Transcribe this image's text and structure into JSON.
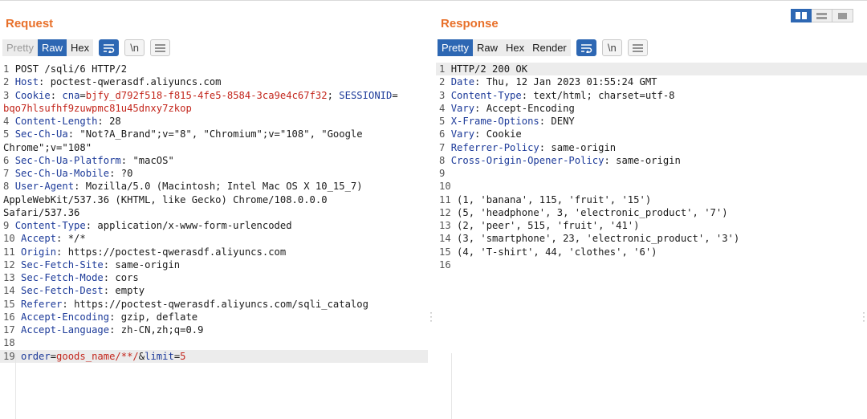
{
  "request": {
    "title": "Request",
    "tabs": [
      "Pretty",
      "Raw",
      "Hex"
    ],
    "active_tab": "Raw",
    "newline_label": "\\n",
    "lines": [
      [
        {
          "t": "1 ",
          "c": "num"
        },
        {
          "t": "POST /sqli/6 HTTP/2"
        }
      ],
      [
        {
          "t": "2 ",
          "c": "num"
        },
        {
          "t": "Host",
          "c": "key"
        },
        {
          "t": ": poctest-qwerasdf.aliyuncs.com"
        }
      ],
      [
        {
          "t": "3 ",
          "c": "num"
        },
        {
          "t": "Cookie",
          "c": "key"
        },
        {
          "t": ": "
        },
        {
          "t": "cna",
          "c": "key"
        },
        {
          "t": "="
        },
        {
          "t": "bjfy_d792f518-f815-4fe5-8584-3ca9e4c67f32",
          "c": "val"
        },
        {
          "t": "; "
        },
        {
          "t": "SESSIONID",
          "c": "key"
        },
        {
          "t": "="
        }
      ],
      [
        {
          "t": "bqo7hlsufhf9zuwpmc81u45dnxy7zkop",
          "c": "val"
        }
      ],
      [
        {
          "t": "4 ",
          "c": "num"
        },
        {
          "t": "Content-Length",
          "c": "key"
        },
        {
          "t": ": 28"
        }
      ],
      [
        {
          "t": "5 ",
          "c": "num"
        },
        {
          "t": "Sec-Ch-Ua",
          "c": "key"
        },
        {
          "t": ": \"Not?A_Brand\";v=\"8\", \"Chromium\";v=\"108\", \"Google"
        }
      ],
      [
        {
          "t": "Chrome\";v=\"108\""
        }
      ],
      [
        {
          "t": "6 ",
          "c": "num"
        },
        {
          "t": "Sec-Ch-Ua-Platform",
          "c": "key"
        },
        {
          "t": ": \"macOS\""
        }
      ],
      [
        {
          "t": "7 ",
          "c": "num"
        },
        {
          "t": "Sec-Ch-Ua-Mobile",
          "c": "key"
        },
        {
          "t": ": ?0"
        }
      ],
      [
        {
          "t": "8 ",
          "c": "num"
        },
        {
          "t": "User-Agent",
          "c": "key"
        },
        {
          "t": ": Mozilla/5.0 (Macintosh; Intel Mac OS X 10_15_7)"
        }
      ],
      [
        {
          "t": "AppleWebKit/537.36 (KHTML, like Gecko) Chrome/108.0.0.0"
        }
      ],
      [
        {
          "t": "Safari/537.36"
        }
      ],
      [
        {
          "t": "9 ",
          "c": "num"
        },
        {
          "t": "Content-Type",
          "c": "key"
        },
        {
          "t": ": application/x-www-form-urlencoded"
        }
      ],
      [
        {
          "t": "10 ",
          "c": "num"
        },
        {
          "t": "Accept",
          "c": "key"
        },
        {
          "t": ": */*"
        }
      ],
      [
        {
          "t": "11 ",
          "c": "num"
        },
        {
          "t": "Origin",
          "c": "key"
        },
        {
          "t": ": https://poctest-qwerasdf.aliyuncs.com"
        }
      ],
      [
        {
          "t": "12 ",
          "c": "num"
        },
        {
          "t": "Sec-Fetch-Site",
          "c": "key"
        },
        {
          "t": ": same-origin"
        }
      ],
      [
        {
          "t": "13 ",
          "c": "num"
        },
        {
          "t": "Sec-Fetch-Mode",
          "c": "key"
        },
        {
          "t": ": cors"
        }
      ],
      [
        {
          "t": "14 ",
          "c": "num"
        },
        {
          "t": "Sec-Fetch-Dest",
          "c": "key"
        },
        {
          "t": ": empty"
        }
      ],
      [
        {
          "t": "15 ",
          "c": "num"
        },
        {
          "t": "Referer",
          "c": "key"
        },
        {
          "t": ": https://poctest-qwerasdf.aliyuncs.com/sqli_catalog"
        }
      ],
      [
        {
          "t": "16 ",
          "c": "num"
        },
        {
          "t": "Accept-Encoding",
          "c": "key"
        },
        {
          "t": ": gzip, deflate"
        }
      ],
      [
        {
          "t": "17 ",
          "c": "num"
        },
        {
          "t": "Accept-Language",
          "c": "key"
        },
        {
          "t": ": zh-CN,zh;q=0.9"
        }
      ],
      [
        {
          "t": "18",
          "c": "num"
        }
      ],
      [
        {
          "t": "19 ",
          "c": "num"
        },
        {
          "t": "order",
          "c": "key"
        },
        {
          "t": "="
        },
        {
          "t": "goods_name/**/",
          "c": "val"
        },
        {
          "t": "&"
        },
        {
          "t": "limit",
          "c": "key"
        },
        {
          "t": "="
        },
        {
          "t": "5",
          "c": "val"
        }
      ]
    ],
    "highlight_line_index": 22
  },
  "response": {
    "title": "Response",
    "tabs": [
      "Pretty",
      "Raw",
      "Hex",
      "Render"
    ],
    "active_tab": "Pretty",
    "newline_label": "\\n",
    "lines": [
      [
        {
          "t": "1 ",
          "c": "num"
        },
        {
          "t": "HTTP/2 200 OK"
        }
      ],
      [
        {
          "t": "2 ",
          "c": "num"
        },
        {
          "t": "Date",
          "c": "key"
        },
        {
          "t": ": Thu, 12 Jan 2023 01:55:24 GMT"
        }
      ],
      [
        {
          "t": "3 ",
          "c": "num"
        },
        {
          "t": "Content-Type",
          "c": "key"
        },
        {
          "t": ": text/html; charset=utf-8"
        }
      ],
      [
        {
          "t": "4 ",
          "c": "num"
        },
        {
          "t": "Vary",
          "c": "key"
        },
        {
          "t": ": Accept-Encoding"
        }
      ],
      [
        {
          "t": "5 ",
          "c": "num"
        },
        {
          "t": "X-Frame-Options",
          "c": "key"
        },
        {
          "t": ": DENY"
        }
      ],
      [
        {
          "t": "6 ",
          "c": "num"
        },
        {
          "t": "Vary",
          "c": "key"
        },
        {
          "t": ": Cookie"
        }
      ],
      [
        {
          "t": "7 ",
          "c": "num"
        },
        {
          "t": "Referrer-Policy",
          "c": "key"
        },
        {
          "t": ": same-origin"
        }
      ],
      [
        {
          "t": "8 ",
          "c": "num"
        },
        {
          "t": "Cross-Origin-Opener-Policy",
          "c": "key"
        },
        {
          "t": ": same-origin"
        }
      ],
      [
        {
          "t": "9",
          "c": "num"
        }
      ],
      [
        {
          "t": "10",
          "c": "num"
        }
      ],
      [
        {
          "t": "11 ",
          "c": "num"
        },
        {
          "t": "(1, 'banana', 115, 'fruit', '15')"
        }
      ],
      [
        {
          "t": "12 ",
          "c": "num"
        },
        {
          "t": "(5, 'headphone', 3, 'electronic_product', '7')"
        }
      ],
      [
        {
          "t": "13 ",
          "c": "num"
        },
        {
          "t": "(2, 'peer', 515, 'fruit', '41')"
        }
      ],
      [
        {
          "t": "14 ",
          "c": "num"
        },
        {
          "t": "(3, 'smartphone', 23, 'electronic_product', '3')"
        }
      ],
      [
        {
          "t": "15 ",
          "c": "num"
        },
        {
          "t": "(4, 'T-shirt', 44, 'clothes', '6')"
        }
      ],
      [
        {
          "t": "16",
          "c": "num"
        }
      ]
    ],
    "highlight_line_index": 0
  },
  "icons": {
    "wrap": "wrap-lines-icon",
    "menu": "menu-icon",
    "layout": [
      "split-columns-icon",
      "split-rows-icon",
      "single-pane-icon"
    ]
  },
  "colors": {
    "accent": "#2d67b3",
    "title": "#e8702a",
    "header_key": "#1c3a99",
    "param_value": "#c3261c",
    "highlight": "#ececec"
  }
}
